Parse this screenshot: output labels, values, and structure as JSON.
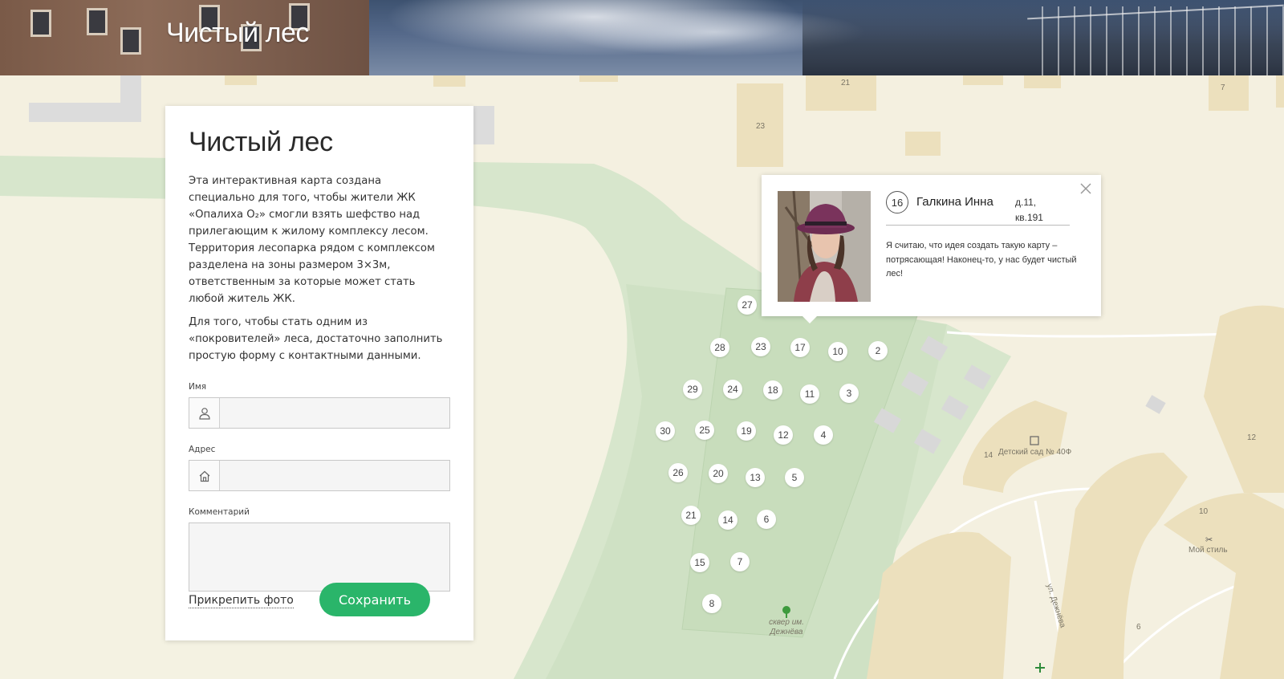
{
  "header": {
    "title": "Чистый лес"
  },
  "panel": {
    "title": "Чистый лес",
    "intro_1": "Эта интерактивная карта создана специально для того, чтобы жители ЖК «Опалиха O₂» смогли взять шефство над прилегающим к жилому комплексу лесом. Территория лесопарка рядом с комплексом разделена на зоны размером 3×3м, ответственным за которые может стать любой житель ЖК.",
    "intro_2": "Для того, чтобы стать одним из «покровителей» леса, достаточно заполнить простую форму с контактными данными.",
    "fields": {
      "name_label": "Имя",
      "name_icon": "user-icon",
      "address_label": "Адрес",
      "address_icon": "home-icon",
      "comment_label": "Комментарий"
    },
    "attach_label": "Прикрепить фото",
    "save_label": "Сохранить"
  },
  "popup": {
    "plot_number": "16",
    "name": "Галкина Инна",
    "address": "д.11, кв.191",
    "comment": "Я считаю, что идея создать такую карту – потрясающая! Наконец-то, у нас будет чистый лес!",
    "close_icon": "close-icon"
  },
  "map": {
    "plots": [
      "27",
      "28",
      "23",
      "17",
      "10",
      "2",
      "29",
      "24",
      "18",
      "11",
      "3",
      "30",
      "25",
      "19",
      "12",
      "4",
      "26",
      "20",
      "13",
      "5",
      "21",
      "14",
      "6",
      "15",
      "7",
      "8"
    ],
    "labels": {
      "b21": "21",
      "b23": "23",
      "b7": "7",
      "b14": "14",
      "kindergarten": "Детский сад № 40Ф",
      "b12": "12",
      "b10": "10",
      "shop": "Мой стиль",
      "street": "ул. Дежнёва",
      "square": "сквер им. Дежнёва",
      "b6": "6"
    }
  },
  "colors": {
    "accent": "#2ab56a",
    "map_background": "#f4f0e0",
    "park": "#cfe1c4",
    "building": "#ece0bd"
  }
}
